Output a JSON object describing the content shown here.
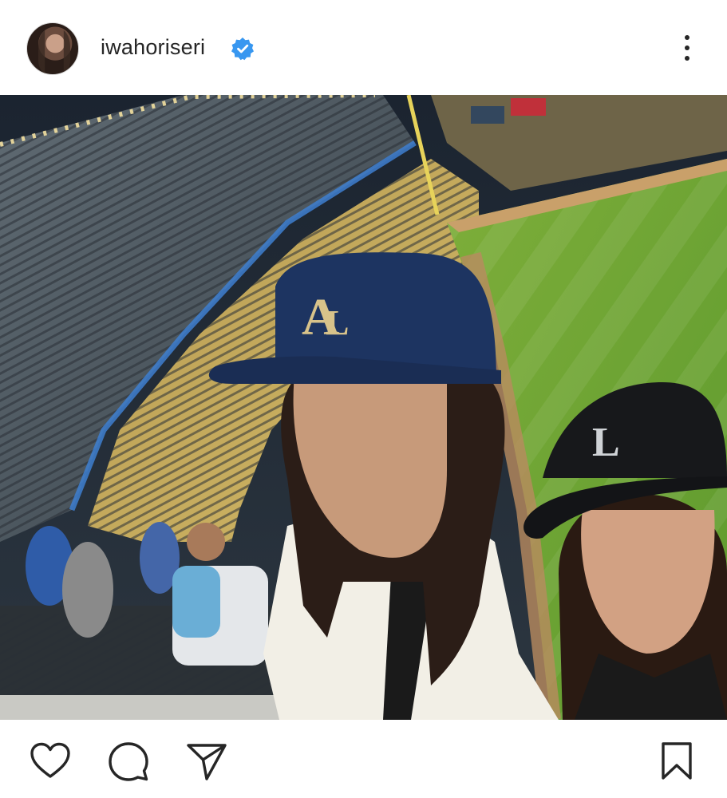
{
  "post": {
    "username": "iwahoriseri",
    "verified": true,
    "icons": {
      "verified": "verified-badge-icon",
      "more": "more-options-icon",
      "like": "heart-icon",
      "comment": "comment-bubble-icon",
      "share": "send-paper-plane-icon",
      "save": "bookmark-icon"
    },
    "colors": {
      "verified_blue": "#3897f0",
      "text": "#262626",
      "background": "#ffffff"
    }
  }
}
